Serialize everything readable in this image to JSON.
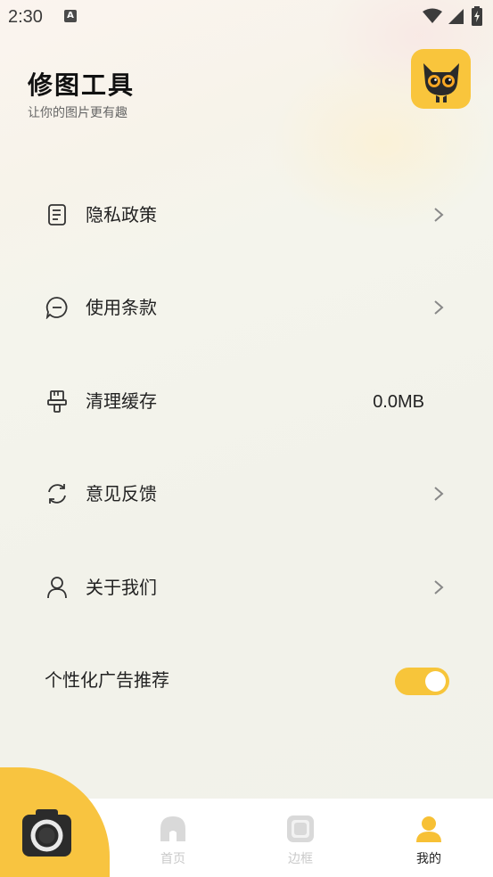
{
  "status_bar": {
    "time": "2:30",
    "notification_badge": "A"
  },
  "header": {
    "title": "修图工具",
    "subtitle": "让你的图片更有趣",
    "avatar": "cat-avatar"
  },
  "menu": [
    {
      "label": "隐私政策",
      "icon": "document-icon",
      "chevron": true
    },
    {
      "label": "使用条款",
      "icon": "chat-bubble-icon",
      "chevron": true
    },
    {
      "label": "清理缓存",
      "icon": "brush-icon",
      "value": "0.0MB"
    },
    {
      "label": "意见反馈",
      "icon": "refresh-icon",
      "chevron": true
    },
    {
      "label": "关于我们",
      "icon": "user-icon",
      "chevron": true
    }
  ],
  "ads": {
    "label": "个性化广告推荐",
    "enabled": true
  },
  "nav": [
    {
      "label": "首页",
      "icon": "home-icon",
      "active": false
    },
    {
      "label": "边框",
      "icon": "frame-icon",
      "active": false
    },
    {
      "label": "我的",
      "icon": "person-icon",
      "active": true
    }
  ],
  "colors": {
    "accent": "#f8c440",
    "background": "#f2f2ea",
    "text": "#222222",
    "inactive": "#c9c9c9"
  }
}
